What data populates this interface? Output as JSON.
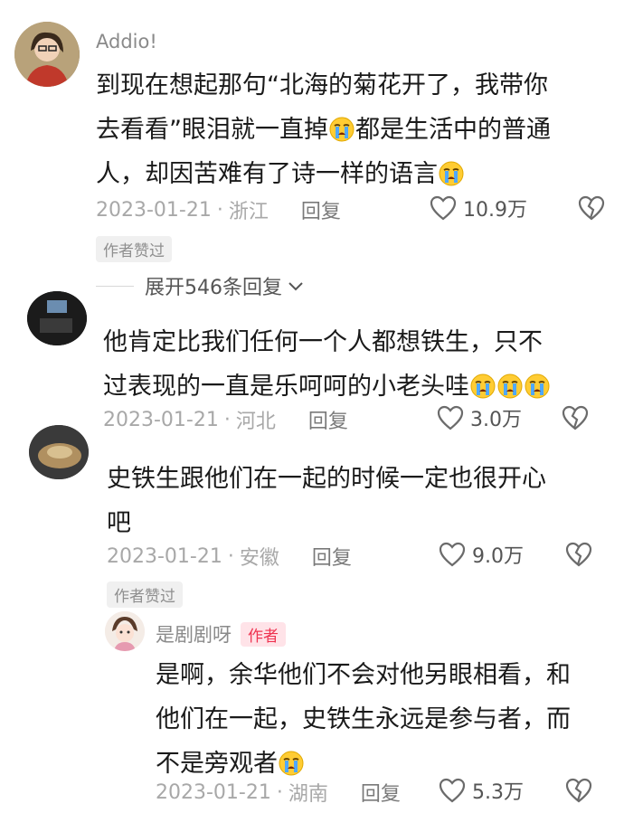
{
  "comments": [
    {
      "username": "Addio!",
      "text_lines": [
        "到现在想起那句“北海的菊花开了，我带你",
        "去看看”眼泪就一直掉",
        "都是生活中的普通",
        "人，却因苦难有了诗一样的语言"
      ],
      "date": "2023-01-21",
      "location": "浙江",
      "reply_label": "回复",
      "likes": "10.9万",
      "badge": "作者赞过",
      "expand_label": "展开546条回复"
    },
    {
      "username": "",
      "text_lines": [
        "他肯定比我们任何一个人都想铁生，只不",
        "过表现的一直是乐呵呵的小老头哇"
      ],
      "date": "2023-01-21",
      "location": "河北",
      "reply_label": "回复",
      "likes": "3.0万"
    },
    {
      "username": "",
      "text_lines": [
        "史铁生跟他们在一起的时候一定也很开心",
        "吧"
      ],
      "date": "2023-01-21",
      "location": "安徽",
      "reply_label": "回复",
      "likes": "9.0万",
      "badge": "作者赞过"
    }
  ],
  "reply": {
    "username": "是剧剧呀",
    "author_tag": "作者",
    "text_lines": [
      "是啊，余华他们不会对他另眼相看，和",
      "他们在一起，史铁生永远是参与者，而",
      "不是旁观者"
    ],
    "date": "2023-01-21",
    "location": "湖南",
    "reply_label": "回复",
    "likes": "5.3万"
  },
  "icons": {
    "like": "heart-outline-icon",
    "dislike": "broken-heart-icon",
    "expand": "chevron-down-icon",
    "emoji": "loudly-crying-face-icon"
  },
  "colors": {
    "meta_gray": "#a8a8a8",
    "author_red": "#ef3350",
    "badge_bg": "#f0f0f0"
  }
}
